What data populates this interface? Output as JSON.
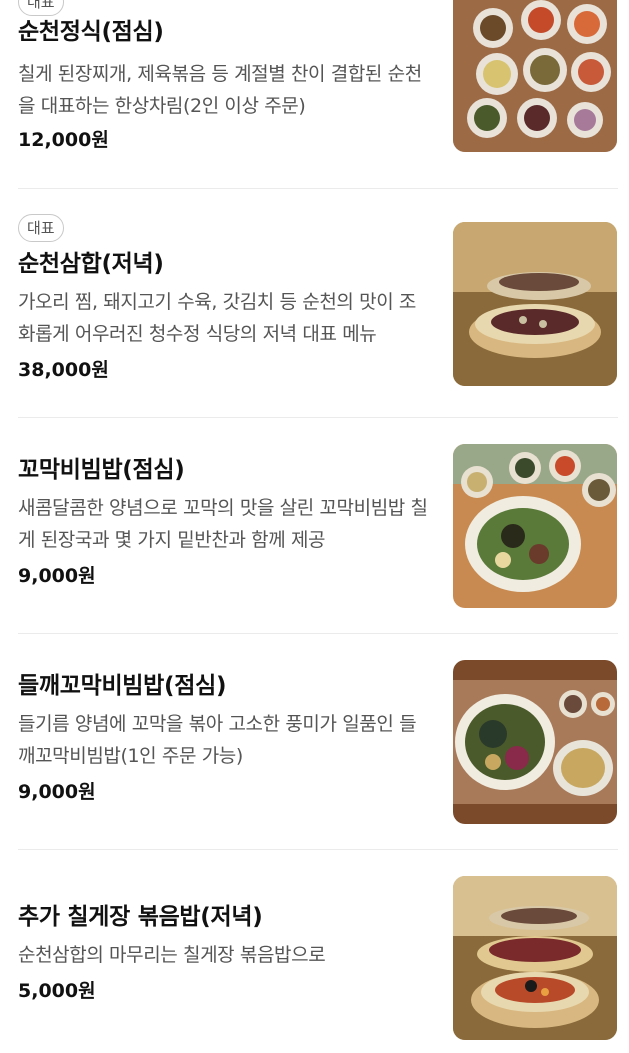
{
  "menu": {
    "items": [
      {
        "badge": "대표",
        "name": "순천정식(점심)",
        "description": "칠게 된장찌개, 제육볶음 등 계절별 찬이 결합된 순천을 대표하는 한상차림(2인 이상 주문)",
        "price": "12,000원",
        "image_icon": "hansang-food-photo-icon"
      },
      {
        "badge": "대표",
        "name": "순천삼합(저녁)",
        "description": "가오리 찜, 돼지고기 수육, 갓김치 등 순천의 맛이 조화롭게 어우러진 청수정 식당의 저녁 대표 메뉴",
        "price": "38,000원",
        "image_icon": "samhap-food-photo-icon"
      },
      {
        "name": "꼬막비빔밥(점심)",
        "description": "새콤달콤한 양념으로 꼬막의 맛을 살린 꼬막비빔밥 칠게 된장국과 몇 가지 밑반찬과 함께 제공",
        "price": "9,000원",
        "image_icon": "bibimbap-food-photo-icon"
      },
      {
        "name": "들깨꼬막비빔밥(점심)",
        "description": "들기름 양념에 꼬막을 볶아 고소한 풍미가 일품인 들깨꼬막비빔밥(1인 주문 가능)",
        "price": "9,000원",
        "image_icon": "perilla-bibimbap-food-photo-icon"
      },
      {
        "name": "추가 칠게장 볶음밥(저녁)",
        "description": "순천삼합의 마무리는 칠게장 볶음밥으로",
        "price": "5,000원",
        "image_icon": "fried-rice-food-photo-icon"
      }
    ]
  },
  "colors": {
    "text_primary": "#111111",
    "text_secondary": "#555555",
    "badge_border": "#c9c9c9",
    "divider": "#ebebeb"
  }
}
